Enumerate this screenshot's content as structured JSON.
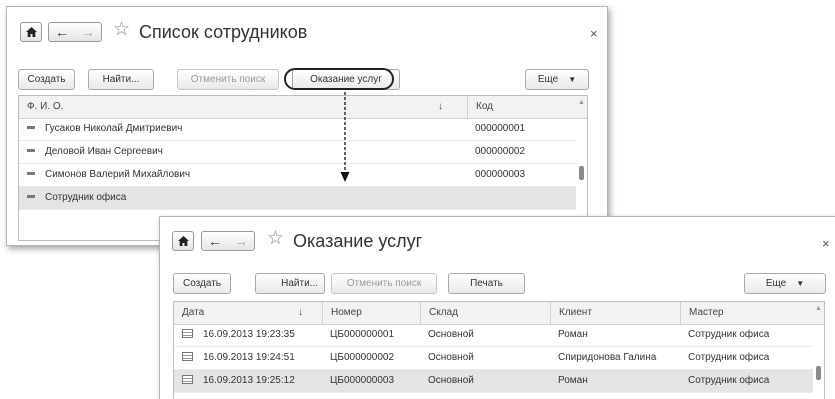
{
  "window1": {
    "title": "Список сотрудников",
    "close": "×",
    "toolbar": {
      "create": "Создать",
      "find": "Найти...",
      "cancel_search": "Отменить поиск",
      "services": "Оказание услуг",
      "more": "Еще"
    },
    "table": {
      "col_name": "Ф. И. О.",
      "sort_arrow": "↓",
      "col_code": "Код",
      "rows": [
        {
          "name": "Гусаков Николай Дмитриевич",
          "code": "000000001"
        },
        {
          "name": "Деловой Иван Сергеевич",
          "code": "000000002"
        },
        {
          "name": "Симонов Валерий Михайлович",
          "code": "000000003"
        },
        {
          "name": "Сотрудник офиса",
          "code": ""
        }
      ]
    }
  },
  "window2": {
    "title": "Оказание услуг",
    "close": "×",
    "toolbar": {
      "create": "Создать",
      "find": "Найти...",
      "cancel_search": "Отменить поиск",
      "print": "Печать",
      "more": "Еще"
    },
    "table": {
      "headers": [
        "Дата",
        "Номер",
        "Склад",
        "Клиент",
        "Мастер"
      ],
      "sort_arrow": "↓",
      "rows": [
        {
          "date": "16.09.2013 19:23:35",
          "number": "ЦБ000000001",
          "warehouse": "Основной",
          "client": "Роман",
          "master": "Сотрудник офиса"
        },
        {
          "date": "16.09.2013 19:24:51",
          "number": "ЦБ000000002",
          "warehouse": "Основной",
          "client": "Спиридонова Галина",
          "master": "Сотрудник офиса"
        },
        {
          "date": "16.09.2013 19:25:12",
          "number": "ЦБ000000003",
          "warehouse": "Основной",
          "client": "Роман",
          "master": "Сотрудник офиса"
        }
      ]
    }
  },
  "icons": {
    "home": "home-icon",
    "back": "arrow-left-icon",
    "forward": "arrow-right-icon",
    "favorite": "star-icon",
    "dropdown": "triangle-down-icon",
    "list_row": "dash-icon",
    "document": "document-icon"
  }
}
